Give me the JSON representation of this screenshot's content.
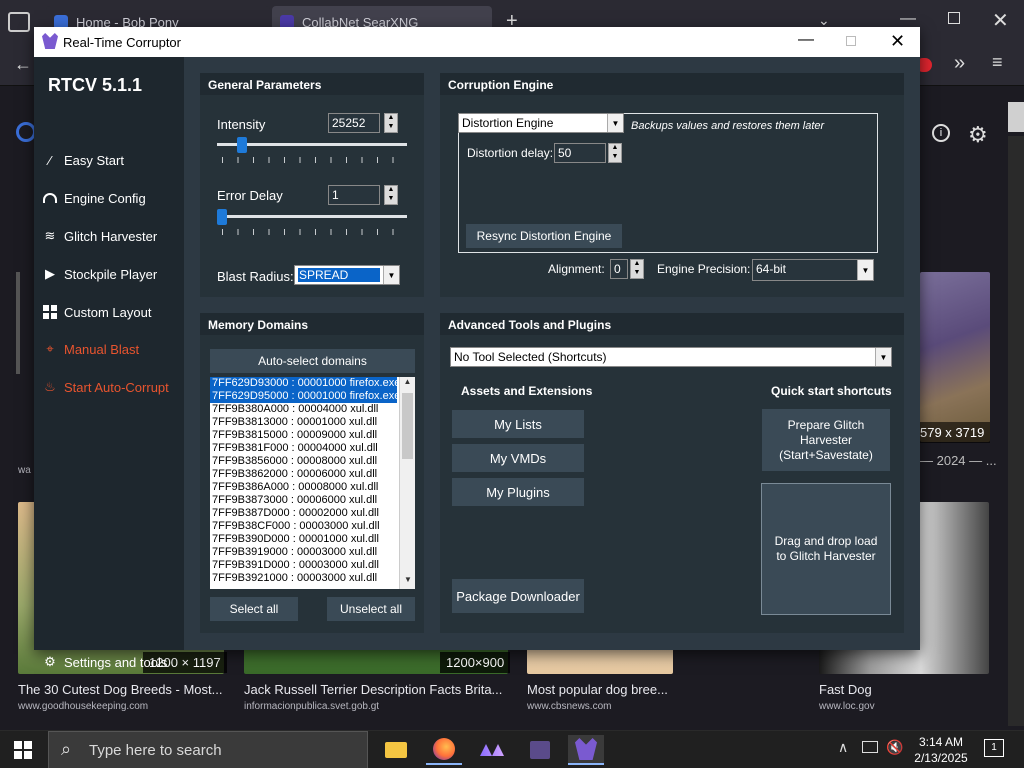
{
  "browser": {
    "tabs": [
      {
        "title": "Home - Bob Pony"
      },
      {
        "title": "CollabNet SearXNG"
      }
    ],
    "new_tab": "+",
    "results": [
      {
        "title": "The 30 Cutest Dog Breeds - Most...",
        "url": "www.goodhousekeeping.com",
        "size": "1200 × 1197"
      },
      {
        "title": "Jack Russell Terrier Description Facts Brita...",
        "url": "informacionpublica.svet.gob.gt",
        "size": "1200×900"
      },
      {
        "title": "Most popular dog bree...",
        "url": "www.cbsnews.com",
        "size": ""
      },
      {
        "title": "Fast Dog",
        "url": "www.loc.gov",
        "size": ""
      }
    ],
    "right_result_size": "579 x 3719",
    "right_result_date": "— 2024 — ...",
    "left_caption": "wa"
  },
  "taskbar": {
    "search_placeholder": "Type here to search",
    "time": "3:14 AM",
    "date": "2/13/2025",
    "notif_count": "1"
  },
  "rtcv": {
    "window_title": "Real-Time Corruptor",
    "app_version": "RTCV 5.1.1",
    "sidebar": [
      {
        "label": "Easy Start",
        "icon": "wand-icon",
        "color": "#ffffff"
      },
      {
        "label": "Engine Config",
        "icon": "gauge-icon",
        "color": "#ffffff"
      },
      {
        "label": "Glitch Harvester",
        "icon": "layers-icon",
        "color": "#ffffff"
      },
      {
        "label": "Stockpile Player",
        "icon": "play-icon",
        "color": "#ffffff"
      },
      {
        "label": "Custom Layout",
        "icon": "grid-icon",
        "color": "#ffffff"
      },
      {
        "label": "Manual Blast",
        "icon": "crosshair-icon",
        "color": "#e8542e"
      },
      {
        "label": "Start Auto-Corrupt",
        "icon": "flame-icon",
        "color": "#e8542e"
      }
    ],
    "settings_label": "Settings and tools",
    "general": {
      "header": "General Parameters",
      "intensity_label": "Intensity",
      "intensity_value": "25252",
      "intensity_slider": 0.11,
      "error_delay_label": "Error Delay",
      "error_delay_value": "1",
      "error_delay_slider": 0.0,
      "blast_radius_label": "Blast Radius:",
      "blast_radius_value": "SPREAD"
    },
    "engine": {
      "header": "Corruption Engine",
      "engine_select": "Distortion Engine",
      "engine_desc": "Backups values and restores them later",
      "delay_label": "Distortion delay:",
      "delay_value": "50",
      "resync_label": "Resync Distortion Engine",
      "alignment_label": "Alignment:",
      "alignment_value": "0",
      "precision_label": "Engine Precision:",
      "precision_value": "64-bit"
    },
    "memory": {
      "header": "Memory Domains",
      "auto_select": "Auto-select domains",
      "domains": [
        {
          "text": "7FF629D93000 : 00001000 firefox.exe",
          "selected": true
        },
        {
          "text": "7FF629D95000 : 00001000 firefox.exe",
          "selected": true
        },
        {
          "text": "7FF9B380A000 : 00004000 xul.dll",
          "selected": false
        },
        {
          "text": "7FF9B3813000 : 00001000 xul.dll",
          "selected": false
        },
        {
          "text": "7FF9B3815000 : 00009000 xul.dll",
          "selected": false
        },
        {
          "text": "7FF9B381F000 : 00004000 xul.dll",
          "selected": false
        },
        {
          "text": "7FF9B3856000 : 00008000 xul.dll",
          "selected": false
        },
        {
          "text": "7FF9B3862000 : 00006000 xul.dll",
          "selected": false
        },
        {
          "text": "7FF9B386A000 : 00008000 xul.dll",
          "selected": false
        },
        {
          "text": "7FF9B3873000 : 00006000 xul.dll",
          "selected": false
        },
        {
          "text": "7FF9B387D000 : 00002000 xul.dll",
          "selected": false
        },
        {
          "text": "7FF9B38CF000 : 00003000 xul.dll",
          "selected": false
        },
        {
          "text": "7FF9B390D000 : 00001000 xul.dll",
          "selected": false
        },
        {
          "text": "7FF9B3919000 : 00003000 xul.dll",
          "selected": false
        },
        {
          "text": "7FF9B391D000 : 00003000 xul.dll",
          "selected": false
        },
        {
          "text": "7FF9B3921000 : 00003000 xul.dll",
          "selected": false
        }
      ],
      "select_all": "Select all",
      "unselect_all": "Unselect all"
    },
    "tools": {
      "header": "Advanced Tools and Plugins",
      "tool_select": "No Tool Selected (Shortcuts)",
      "assets_label": "Assets and Extensions",
      "quick_label": "Quick start shortcuts",
      "my_lists": "My Lists",
      "my_vmds": "My VMDs",
      "my_plugins": "My Plugins",
      "package_downloader": "Package Downloader",
      "prepare": "Prepare Glitch Harvester (Start+Savestate)",
      "dragdrop": "Drag and drop load to Glitch Harvester"
    }
  }
}
